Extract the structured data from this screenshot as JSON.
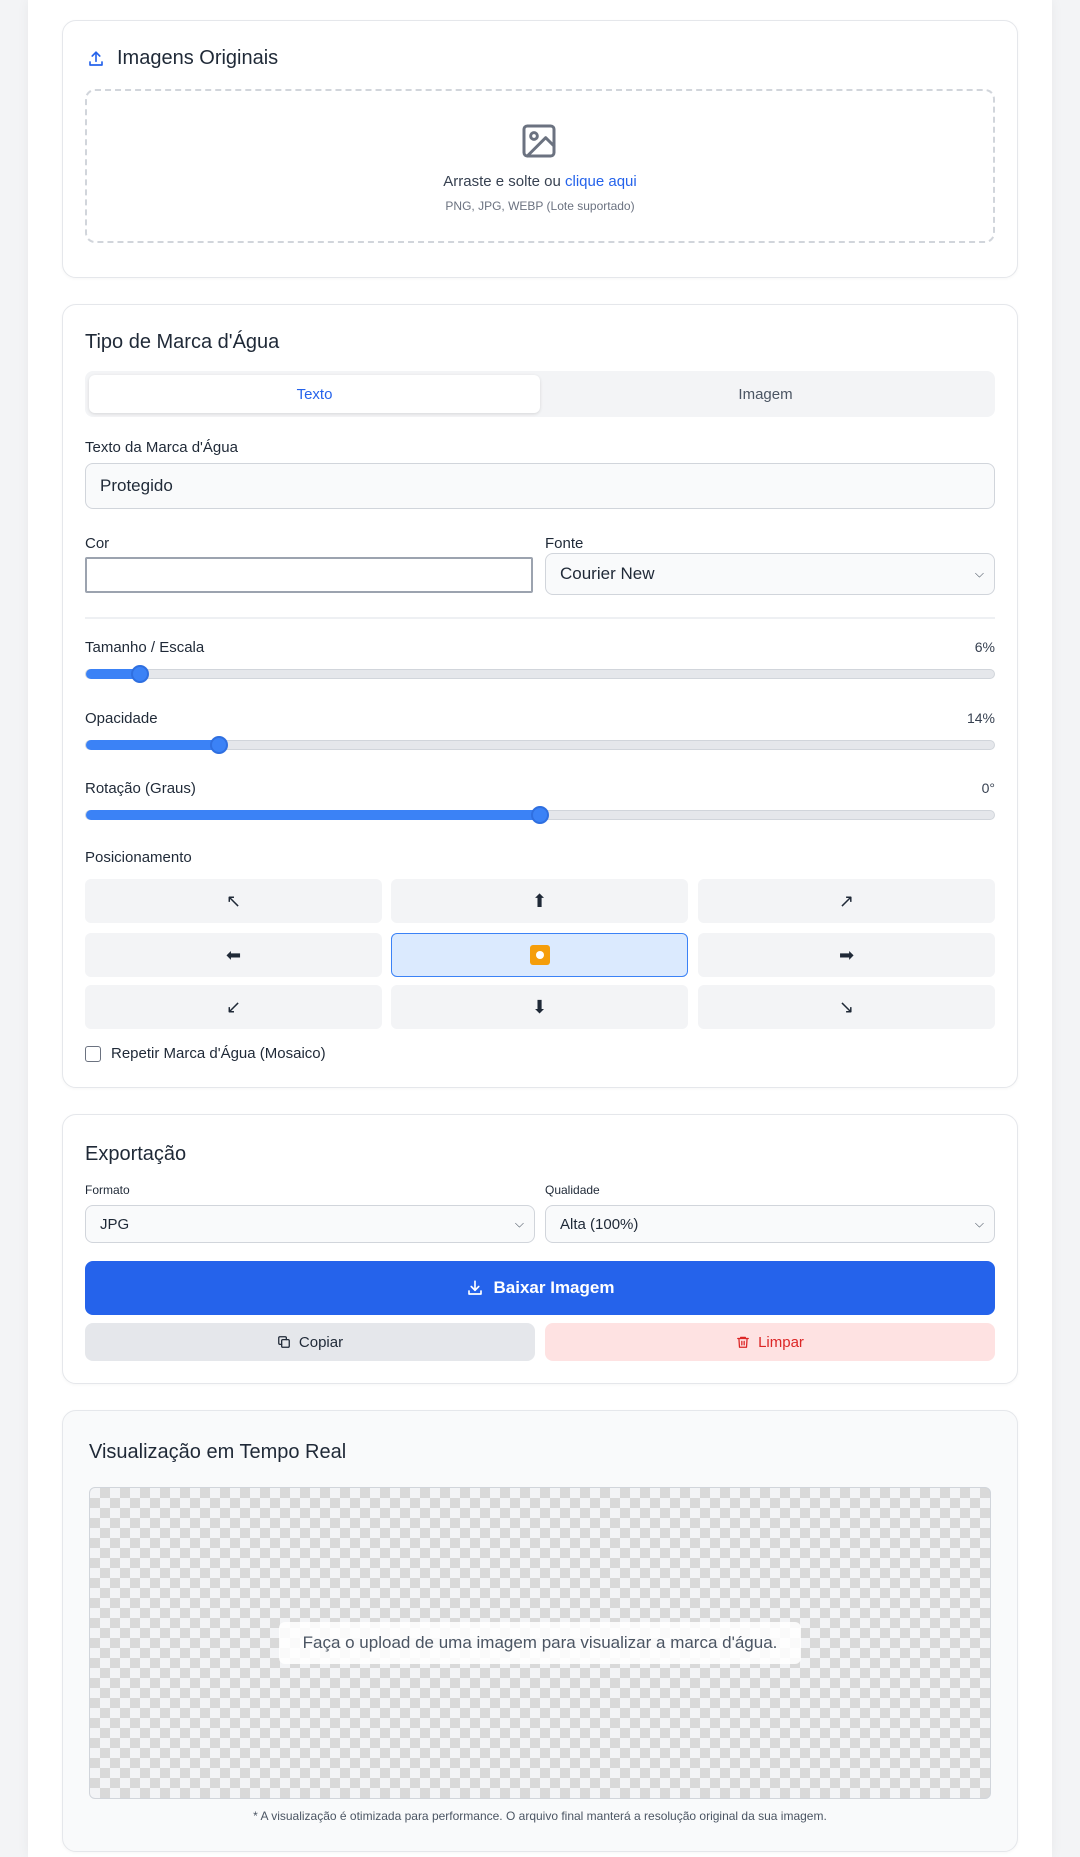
{
  "upload": {
    "title": "Imagens Originais",
    "icon": "upload-icon",
    "drop_text": "Arraste e solte ou",
    "drop_link": "clique aqui",
    "formats": "PNG, JPG, WEBP (Lote suportado)"
  },
  "watermark": {
    "title": "Tipo de Marca d'Água",
    "tabs": [
      {
        "label": "Texto",
        "active": true
      },
      {
        "label": "Imagem",
        "active": false
      }
    ],
    "text_label": "Texto da Marca d'Água",
    "text_value": "Protegido",
    "color_label": "Cor",
    "color_value": "#ffffff",
    "font_label": "Fonte",
    "font_value": "Courier New",
    "size_label": "Tamanho / Escala",
    "size_value": "6%",
    "size_fraction": 0.06,
    "opacity_label": "Opacidade",
    "opacity_value": "14%",
    "opacity_fraction": 0.147,
    "rotation_label": "Rotação (Graus)",
    "rotation_value": "0°",
    "rotation_fraction": 0.5,
    "position_label": "Posicionamento",
    "positions": [
      "↖",
      "⬆",
      "↗",
      "⬅",
      "center",
      "➡",
      "↙",
      "⬇",
      "↘"
    ],
    "selected_position": "center",
    "mosaic_label": "Repetir Marca d'Água (Mosaico)",
    "mosaic_checked": false
  },
  "export": {
    "title": "Exportação",
    "format_label": "Formato",
    "format_value": "JPG",
    "quality_label": "Qualidade",
    "quality_value": "Alta (100%)",
    "download_label": "Baixar Imagem",
    "copy_label": "Copiar",
    "clear_label": "Limpar"
  },
  "preview": {
    "title": "Visualização em Tempo Real",
    "placeholder": "Faça o upload de uma imagem para visualizar a marca d'água.",
    "note": "* A visualização é otimizada para performance. O arquivo final manterá a resolução original da sua imagem."
  },
  "colors": {
    "accent": "#2563eb",
    "slider": "#3b82f6",
    "danger": "#dc2626",
    "danger_bg": "#fee2e2"
  }
}
